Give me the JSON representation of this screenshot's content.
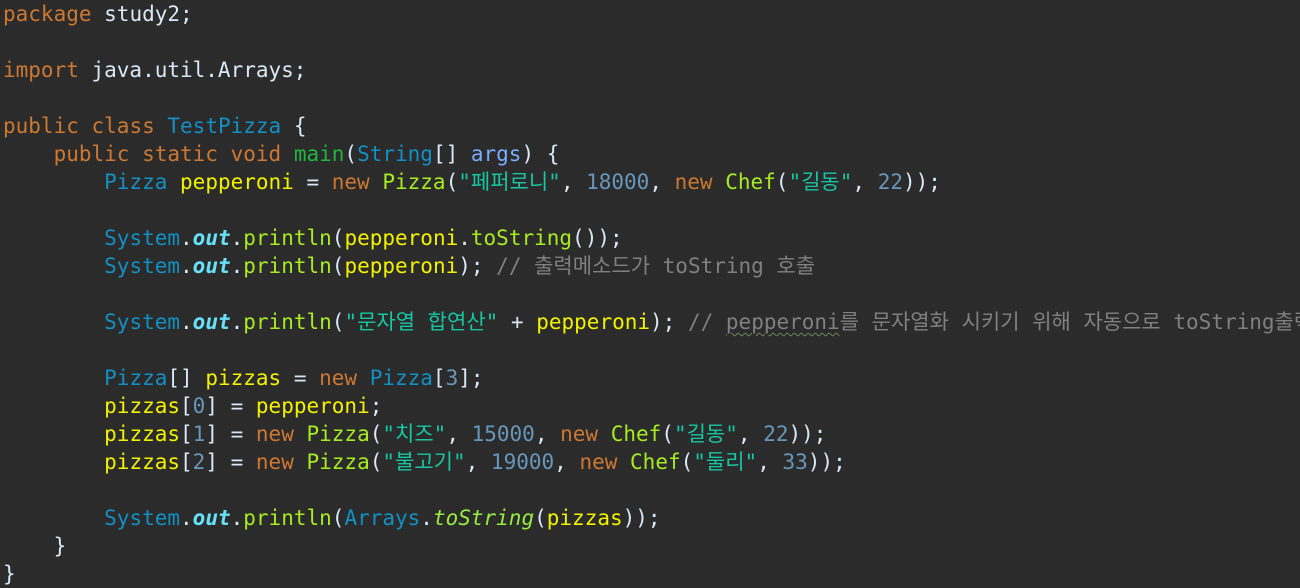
{
  "code_lines": [
    [
      {
        "t": "package",
        "c": "k"
      },
      {
        "t": " study2;",
        "c": "p"
      }
    ],
    [],
    [
      {
        "t": "import",
        "c": "k"
      },
      {
        "t": " java.util.Arrays;",
        "c": "p"
      }
    ],
    [],
    [
      {
        "t": "public",
        "c": "k"
      },
      {
        "t": " ",
        "c": "p"
      },
      {
        "t": "class",
        "c": "k"
      },
      {
        "t": " ",
        "c": "p"
      },
      {
        "t": "TestPizza",
        "c": "cls"
      },
      {
        "t": " {",
        "c": "p"
      }
    ],
    [
      {
        "t": "    ",
        "c": "p"
      },
      {
        "t": "public",
        "c": "k"
      },
      {
        "t": " ",
        "c": "p"
      },
      {
        "t": "static",
        "c": "k"
      },
      {
        "t": " ",
        "c": "p"
      },
      {
        "t": "void",
        "c": "k"
      },
      {
        "t": " ",
        "c": "p"
      },
      {
        "t": "main",
        "c": "m"
      },
      {
        "t": "(",
        "c": "p"
      },
      {
        "t": "String",
        "c": "cls"
      },
      {
        "t": "[] ",
        "c": "p"
      },
      {
        "t": "args",
        "c": "param"
      },
      {
        "t": ") {",
        "c": "p"
      }
    ],
    [
      {
        "t": "        ",
        "c": "p"
      },
      {
        "t": "Pizza",
        "c": "cls"
      },
      {
        "t": " ",
        "c": "p"
      },
      {
        "t": "pepperoni",
        "c": "lv"
      },
      {
        "t": " = ",
        "c": "p"
      },
      {
        "t": "new",
        "c": "k"
      },
      {
        "t": " ",
        "c": "p"
      },
      {
        "t": "Pizza",
        "c": "mc"
      },
      {
        "t": "(",
        "c": "p"
      },
      {
        "t": "\"페퍼로니\"",
        "c": "str"
      },
      {
        "t": ", ",
        "c": "p"
      },
      {
        "t": "18000",
        "c": "num"
      },
      {
        "t": ", ",
        "c": "p"
      },
      {
        "t": "new",
        "c": "k"
      },
      {
        "t": " ",
        "c": "p"
      },
      {
        "t": "Chef",
        "c": "mc"
      },
      {
        "t": "(",
        "c": "p"
      },
      {
        "t": "\"길동\"",
        "c": "str"
      },
      {
        "t": ", ",
        "c": "p"
      },
      {
        "t": "22",
        "c": "num"
      },
      {
        "t": "));",
        "c": "p"
      }
    ],
    [],
    [
      {
        "t": "        ",
        "c": "p"
      },
      {
        "t": "System",
        "c": "sys"
      },
      {
        "t": ".",
        "c": "p"
      },
      {
        "t": "out",
        "c": "sfo"
      },
      {
        "t": ".",
        "c": "p"
      },
      {
        "t": "println",
        "c": "mc"
      },
      {
        "t": "(",
        "c": "p"
      },
      {
        "t": "pepperoni",
        "c": "lv"
      },
      {
        "t": ".",
        "c": "p"
      },
      {
        "t": "toString",
        "c": "mc"
      },
      {
        "t": "());",
        "c": "p"
      }
    ],
    [
      {
        "t": "        ",
        "c": "p"
      },
      {
        "t": "System",
        "c": "sys"
      },
      {
        "t": ".",
        "c": "p"
      },
      {
        "t": "out",
        "c": "sfo"
      },
      {
        "t": ".",
        "c": "p"
      },
      {
        "t": "println",
        "c": "mc"
      },
      {
        "t": "(",
        "c": "p"
      },
      {
        "t": "pepperoni",
        "c": "lv"
      },
      {
        "t": "); ",
        "c": "p"
      },
      {
        "t": "// 출력메소드가 toString 호출",
        "c": "cm"
      }
    ],
    [],
    [
      {
        "t": "        ",
        "c": "p"
      },
      {
        "t": "System",
        "c": "sys"
      },
      {
        "t": ".",
        "c": "p"
      },
      {
        "t": "out",
        "c": "sfo"
      },
      {
        "t": ".",
        "c": "p"
      },
      {
        "t": "println",
        "c": "mc"
      },
      {
        "t": "(",
        "c": "p"
      },
      {
        "t": "\"문자열 합연산\"",
        "c": "str"
      },
      {
        "t": " + ",
        "c": "p"
      },
      {
        "t": "pepperoni",
        "c": "lv"
      },
      {
        "t": "); ",
        "c": "p"
      },
      {
        "t": "// ",
        "c": "cm"
      },
      {
        "t": "pepperoni",
        "c": "cm squiggle"
      },
      {
        "t": "를 문자열화 시키기 위해 자동으로 toString출력",
        "c": "cm"
      }
    ],
    [],
    [
      {
        "t": "        ",
        "c": "p"
      },
      {
        "t": "Pizza",
        "c": "cls"
      },
      {
        "t": "[] ",
        "c": "p"
      },
      {
        "t": "pizzas",
        "c": "lv"
      },
      {
        "t": " = ",
        "c": "p"
      },
      {
        "t": "new",
        "c": "k"
      },
      {
        "t": " ",
        "c": "p"
      },
      {
        "t": "Pizza",
        "c": "cls"
      },
      {
        "t": "[",
        "c": "p"
      },
      {
        "t": "3",
        "c": "num"
      },
      {
        "t": "];",
        "c": "p"
      }
    ],
    [
      {
        "t": "        ",
        "c": "p"
      },
      {
        "t": "pizzas",
        "c": "lv"
      },
      {
        "t": "[",
        "c": "p"
      },
      {
        "t": "0",
        "c": "num"
      },
      {
        "t": "] = ",
        "c": "p"
      },
      {
        "t": "pepperoni",
        "c": "lv"
      },
      {
        "t": ";",
        "c": "p"
      }
    ],
    [
      {
        "t": "        ",
        "c": "p"
      },
      {
        "t": "pizzas",
        "c": "lv"
      },
      {
        "t": "[",
        "c": "p"
      },
      {
        "t": "1",
        "c": "num"
      },
      {
        "t": "] = ",
        "c": "p"
      },
      {
        "t": "new",
        "c": "k"
      },
      {
        "t": " ",
        "c": "p"
      },
      {
        "t": "Pizza",
        "c": "mc"
      },
      {
        "t": "(",
        "c": "p"
      },
      {
        "t": "\"치즈\"",
        "c": "str"
      },
      {
        "t": ", ",
        "c": "p"
      },
      {
        "t": "15000",
        "c": "num"
      },
      {
        "t": ", ",
        "c": "p"
      },
      {
        "t": "new",
        "c": "k"
      },
      {
        "t": " ",
        "c": "p"
      },
      {
        "t": "Chef",
        "c": "mc"
      },
      {
        "t": "(",
        "c": "p"
      },
      {
        "t": "\"길동\"",
        "c": "str"
      },
      {
        "t": ", ",
        "c": "p"
      },
      {
        "t": "22",
        "c": "num"
      },
      {
        "t": "));",
        "c": "p"
      }
    ],
    [
      {
        "t": "        ",
        "c": "p"
      },
      {
        "t": "pizzas",
        "c": "lv"
      },
      {
        "t": "[",
        "c": "p"
      },
      {
        "t": "2",
        "c": "num"
      },
      {
        "t": "] = ",
        "c": "p"
      },
      {
        "t": "new",
        "c": "k"
      },
      {
        "t": " ",
        "c": "p"
      },
      {
        "t": "Pizza",
        "c": "mc"
      },
      {
        "t": "(",
        "c": "p"
      },
      {
        "t": "\"불고기\"",
        "c": "str"
      },
      {
        "t": ", ",
        "c": "p"
      },
      {
        "t": "19000",
        "c": "num"
      },
      {
        "t": ", ",
        "c": "p"
      },
      {
        "t": "new",
        "c": "k"
      },
      {
        "t": " ",
        "c": "p"
      },
      {
        "t": "Chef",
        "c": "mc"
      },
      {
        "t": "(",
        "c": "p"
      },
      {
        "t": "\"둘리\"",
        "c": "str"
      },
      {
        "t": ", ",
        "c": "p"
      },
      {
        "t": "33",
        "c": "num"
      },
      {
        "t": "));",
        "c": "p"
      }
    ],
    [],
    [
      {
        "t": "        ",
        "c": "p"
      },
      {
        "t": "System",
        "c": "sys"
      },
      {
        "t": ".",
        "c": "p"
      },
      {
        "t": "out",
        "c": "sfo"
      },
      {
        "t": ".",
        "c": "p"
      },
      {
        "t": "println",
        "c": "mc"
      },
      {
        "t": "(",
        "c": "p"
      },
      {
        "t": "Arrays",
        "c": "cls"
      },
      {
        "t": ".",
        "c": "p"
      },
      {
        "t": "toString",
        "c": "italic-m"
      },
      {
        "t": "(",
        "c": "p"
      },
      {
        "t": "pizzas",
        "c": "lv"
      },
      {
        "t": "));",
        "c": "p"
      }
    ],
    [
      {
        "t": "    }",
        "c": "p"
      }
    ],
    [
      {
        "t": "}",
        "c": "p"
      }
    ]
  ],
  "colors": {
    "background": "#2b2b2b",
    "keyword": "#cc7832",
    "type": "#1290c3",
    "local_variable": "#f2f200",
    "string": "#17c6a3",
    "number": "#6897bb",
    "comment": "#808080",
    "method_call": "#a7ec21",
    "method_declaration": "#1eb540",
    "static_field": "#66e1f8",
    "parameter": "#79abff",
    "plain": "#d9e8f7"
  }
}
